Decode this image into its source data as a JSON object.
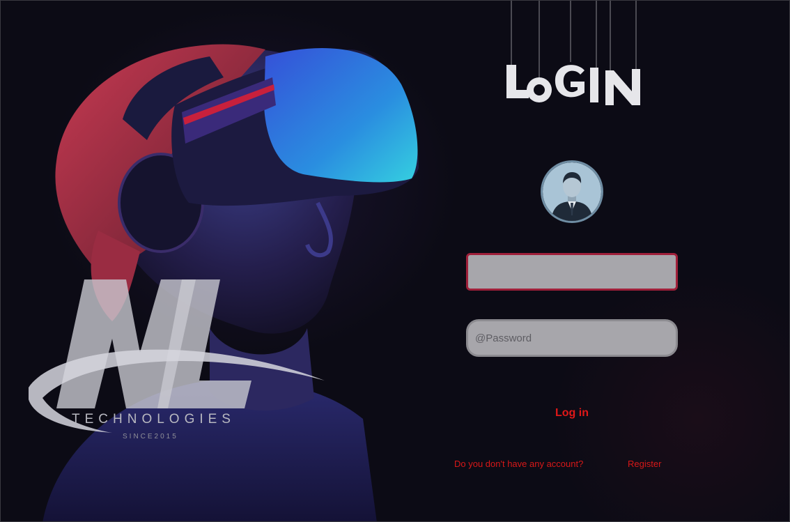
{
  "header": {
    "title": "LoGIN"
  },
  "form": {
    "username": {
      "value": "",
      "placeholder": ""
    },
    "password": {
      "value": "",
      "placeholder": "@Password"
    },
    "login_label": "Log in"
  },
  "footer": {
    "no_account_text": "Do you don't have any account?",
    "register_label": "Register"
  },
  "brand": {
    "letters": "NL",
    "name": "TECHNOLOGIES",
    "since": "SINCE2015"
  },
  "colors": {
    "accent": "#e01818",
    "field_bg": "#a7a6ab",
    "background": "#0c0b15"
  },
  "icons": {
    "avatar": "user-avatar-icon"
  }
}
